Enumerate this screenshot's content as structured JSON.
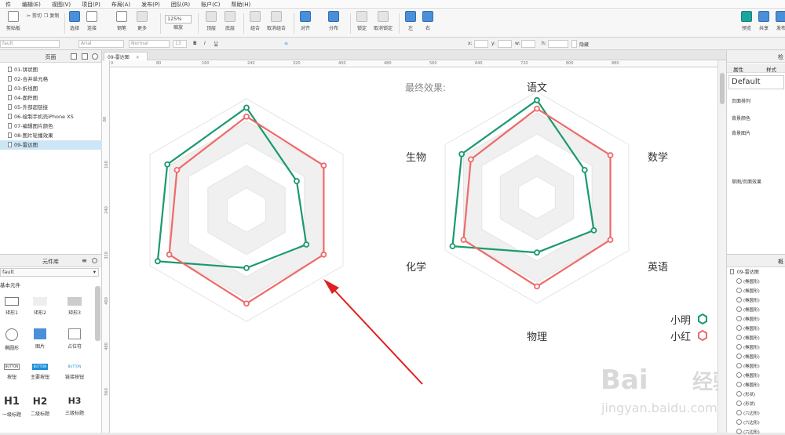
{
  "menubar": [
    "件",
    "编辑(E)",
    "视图(V)",
    "项目(P)",
    "布局(A)",
    "发布(P)",
    "团队(R)",
    "账户(C)",
    "帮助(H)"
  ],
  "toolbar": {
    "paste_label": "剪贴板",
    "buttons": [
      "选择",
      "连接",
      "钢笔",
      "更多",
      "顶层",
      "底层",
      "组合",
      "取消组合",
      "对齐",
      "分布",
      "锁定",
      "取消锁定",
      "左",
      "右"
    ],
    "zoom_value": "125%",
    "zoom_label": "缩放",
    "right_buttons": [
      "预览",
      "共享",
      "发布"
    ],
    "cut_label": "剪切",
    "copy_label": "复制"
  },
  "formatbar": {
    "style": "fault",
    "font": "Arial",
    "weight": "Normal",
    "size": "13",
    "x_label": "x:",
    "y_label": "y:",
    "w_label": "w:",
    "h_label": "h:",
    "hidden_label": "隐藏"
  },
  "pages_panel": {
    "title": "页面",
    "items": [
      "01-饼状图",
      "02-合并单元格",
      "03-折线图",
      "04-面积图",
      "05-外部超链接",
      "06-绘制手机壳iPhone XS",
      "07-编辑图片颜色",
      "08-图片轮播效果",
      "09-雷达图"
    ],
    "selected_index": 8
  },
  "widget_panel": {
    "title": "元件库",
    "library": "fault",
    "category": "基本元件",
    "widgets": [
      {
        "label": "矩形1",
        "icon": "rect-outline-icon"
      },
      {
        "label": "矩形2",
        "icon": "rect-light-icon"
      },
      {
        "label": "矩形3",
        "icon": "rect-gray-icon"
      },
      {
        "label": "椭圆形",
        "icon": "ellipse-icon"
      },
      {
        "label": "图片",
        "icon": "image-icon"
      },
      {
        "label": "占位符",
        "icon": "placeholder-icon"
      },
      {
        "label": "按钮",
        "icon": "button-icon"
      },
      {
        "label": "主要按钮",
        "icon": "primary-button-icon"
      },
      {
        "label": "链接按钮",
        "icon": "link-button-icon"
      },
      {
        "label": "一级标题",
        "icon": "h1-icon"
      },
      {
        "label": "二级标题",
        "icon": "h2-icon"
      },
      {
        "label": "三级标题",
        "icon": "h3-icon"
      }
    ],
    "button_text": "BUTTON",
    "h1": "H1",
    "h2": "H2",
    "h3": "H3"
  },
  "tab": {
    "label": "09-雷达图",
    "close": "×"
  },
  "ruler": {
    "h_ticks": [
      "0",
      "80",
      "160",
      "240",
      "320",
      "400",
      "480",
      "560",
      "640",
      "720",
      "800",
      "880"
    ],
    "v_ticks": [
      "80",
      "160",
      "240",
      "320",
      "400",
      "480",
      "560"
    ]
  },
  "inspector": {
    "tab_props": "属性",
    "tab_style": "样式",
    "page_name": "Default",
    "sections": [
      "页面排列",
      "背景颜色",
      "背景图片",
      "草图/页面效果"
    ],
    "panel_title": "检"
  },
  "outline": {
    "title": "概",
    "page": "09-雷达图",
    "items": [
      "(椭圆形)",
      "(椭圆形)",
      "(椭圆形)",
      "(椭圆形)",
      "(椭圆形)",
      "(椭圆形)",
      "(椭圆形)",
      "(椭圆形)",
      "(椭圆形)",
      "(椭圆形)",
      "(椭圆形)",
      "(椭圆形)",
      "(形状)",
      "(形状)",
      "(六边形)",
      "(六边形)",
      "(六边形)"
    ]
  },
  "chart_right": {
    "caption": "最终效果:",
    "axes": [
      "语文",
      "数学",
      "英语",
      "物理",
      "化学",
      "生物"
    ],
    "legend": [
      "小明",
      "小红"
    ]
  },
  "chart_data": [
    {
      "type": "radar",
      "axes": [
        "语文",
        "数学",
        "英语",
        "物理",
        "化学",
        "生物"
      ],
      "max": 100,
      "series": [
        {
          "name": "小明",
          "color": "#1a9a6c",
          "values": [
            92,
            52,
            62,
            52,
            92,
            82
          ]
        },
        {
          "name": "小红",
          "color": "#ef6a6a",
          "values": [
            84,
            80,
            80,
            84,
            80,
            72
          ]
        }
      ]
    },
    {
      "type": "radar",
      "axes": [
        "语文",
        "数学",
        "英语",
        "物理",
        "化学",
        "生物"
      ],
      "max": 100,
      "series": [
        {
          "name": "小明",
          "color": "#1a9a6c",
          "values": [
            92,
            52,
            62,
            52,
            92,
            82
          ]
        },
        {
          "name": "小红",
          "color": "#ef6a6a",
          "values": [
            84,
            80,
            80,
            84,
            80,
            72
          ]
        }
      ]
    }
  ],
  "watermark": {
    "brand": "Bai",
    "brand2": "经验",
    "url": "jingyan.baidu.com"
  },
  "colors": {
    "accent_green": "#1a9a6c",
    "accent_red": "#ef6a6a",
    "arrow": "#e02020",
    "selection": "#cde6f7"
  }
}
